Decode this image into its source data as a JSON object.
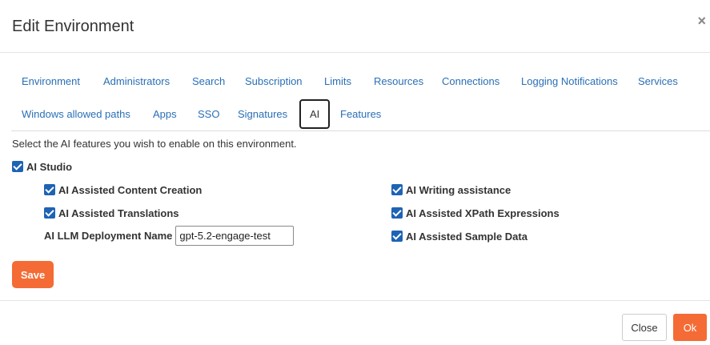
{
  "dialog": {
    "title": "Edit Environment",
    "close_symbol": "×"
  },
  "tabs": [
    {
      "label": "Environment"
    },
    {
      "label": "Administrators"
    },
    {
      "label": "Search"
    },
    {
      "label": "Subscription"
    },
    {
      "label": "Limits"
    },
    {
      "label": "Resources"
    },
    {
      "label": "Connections"
    },
    {
      "label": "Logging Notifications"
    },
    {
      "label": "Services"
    },
    {
      "label": "Windows allowed paths"
    },
    {
      "label": "Apps"
    },
    {
      "label": "SSO"
    },
    {
      "label": "Signatures"
    },
    {
      "label": "AI",
      "active": true
    },
    {
      "label": "Features"
    }
  ],
  "ai": {
    "description": "Select the AI features you wish to enable on this environment.",
    "ai_studio": {
      "label": "AI Studio",
      "checked": true
    },
    "options_left": [
      {
        "label": "AI Assisted Content Creation",
        "checked": true
      },
      {
        "label": "AI Assisted Translations",
        "checked": true
      }
    ],
    "options_right": [
      {
        "label": "AI Writing assistance",
        "checked": true
      },
      {
        "label": "AI Assisted XPath Expressions",
        "checked": true
      },
      {
        "label": "AI Assisted Sample Data",
        "checked": true
      }
    ],
    "llm_label": "AI LLM Deployment Name",
    "llm_value": "gpt-5.2-engage-test",
    "save_label": "Save"
  },
  "footer": {
    "close_label": "Close",
    "ok_label": "Ok"
  },
  "colors": {
    "accent": "#f46b35",
    "link": "#2a6fb6",
    "checkbox": "#1e63b4"
  }
}
